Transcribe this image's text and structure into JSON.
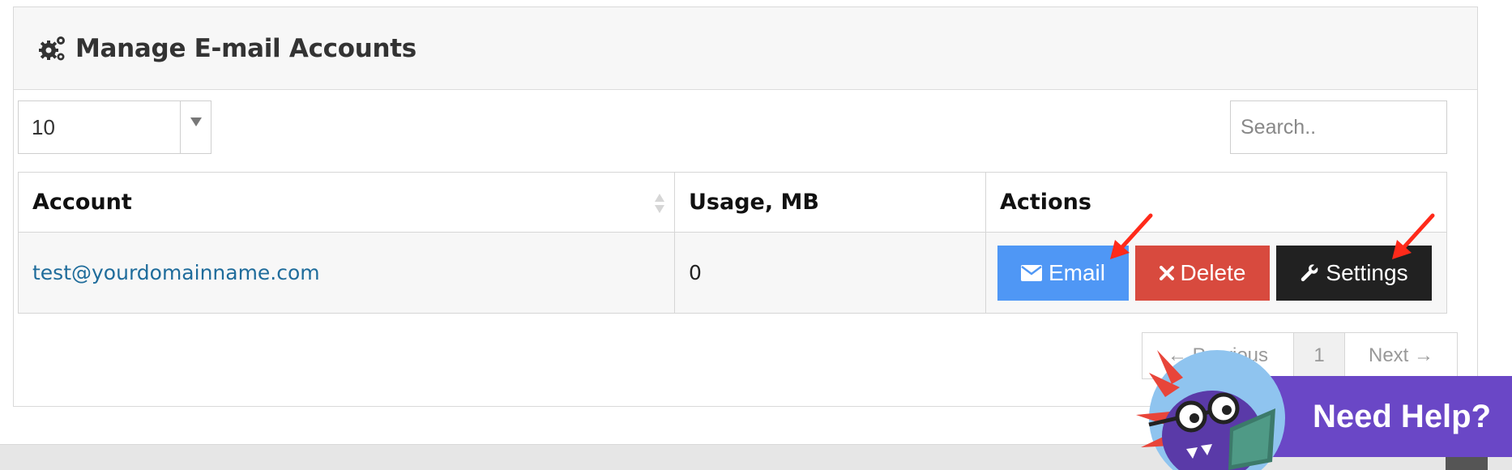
{
  "panel": {
    "title": "Manage E-mail Accounts",
    "icon": "gears-icon"
  },
  "controls": {
    "page_length": "10",
    "search_placeholder": "Search.."
  },
  "table": {
    "columns": [
      "Account",
      "Usage, MB",
      "Actions"
    ],
    "rows": [
      {
        "account": "test@yourdomainname.com",
        "usage": "0",
        "actions": {
          "email": "Email",
          "delete": "Delete",
          "settings": "Settings"
        }
      }
    ]
  },
  "pagination": {
    "previous": "← Previous",
    "current": "1",
    "next": "Next →"
  },
  "help_widget": {
    "label": "Need Help?"
  },
  "colors": {
    "email_button": "#4f97f5",
    "delete_button": "#d84a3e",
    "settings_button": "#212121",
    "link": "#1f6c9b",
    "help_widget": "#6a47c6",
    "annotation_arrow": "#ff2a1a"
  }
}
